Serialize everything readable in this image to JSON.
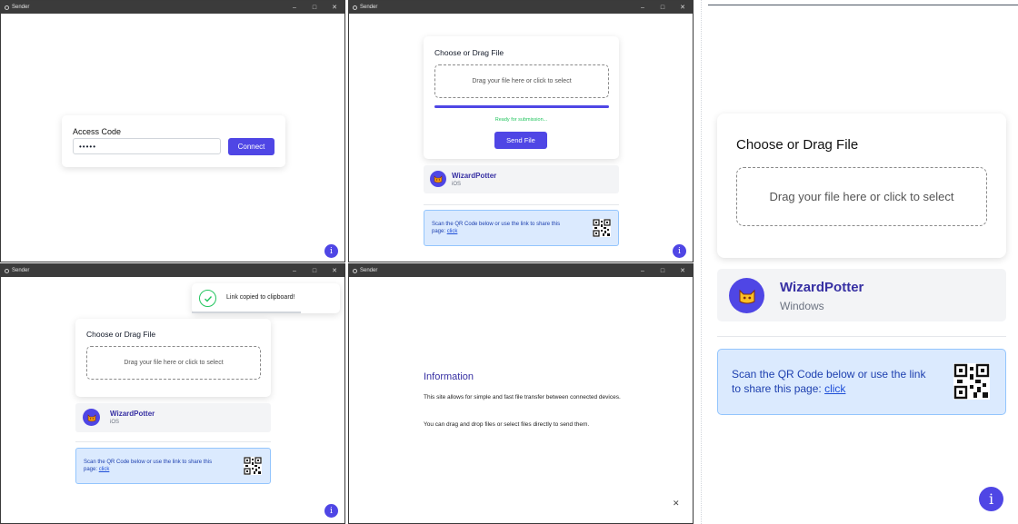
{
  "app": {
    "title": "Sender",
    "minimize": "–",
    "maximize": "□",
    "close": "✕"
  },
  "login": {
    "label": "Access Code",
    "value": "•••••",
    "connect": "Connect"
  },
  "upload": {
    "card_title": "Choose or Drag File",
    "drop_text": "Drag your file here or click to select",
    "progress": 1.0,
    "status": "Ready for submission...",
    "send": "Send File"
  },
  "device_ios": {
    "name": "WizardPotter",
    "os": "iOS"
  },
  "device_windows": {
    "name": "WizardPotter",
    "os": "Windows"
  },
  "share": {
    "text_main": "Scan the QR Code below or use the link to share this page: ",
    "link": "click"
  },
  "toast": {
    "message": "Link copied to clipboard!"
  },
  "info": {
    "title": "Information",
    "p1": "This site allows for simple and fast file transfer between connected devices.",
    "p2": "You can drag and drop files or select files directly to send them.",
    "close": "✕"
  },
  "info_button": "i",
  "colors": {
    "accent": "#4f46e5",
    "success": "#22c55e",
    "titlebar": "#3b3b3b"
  }
}
